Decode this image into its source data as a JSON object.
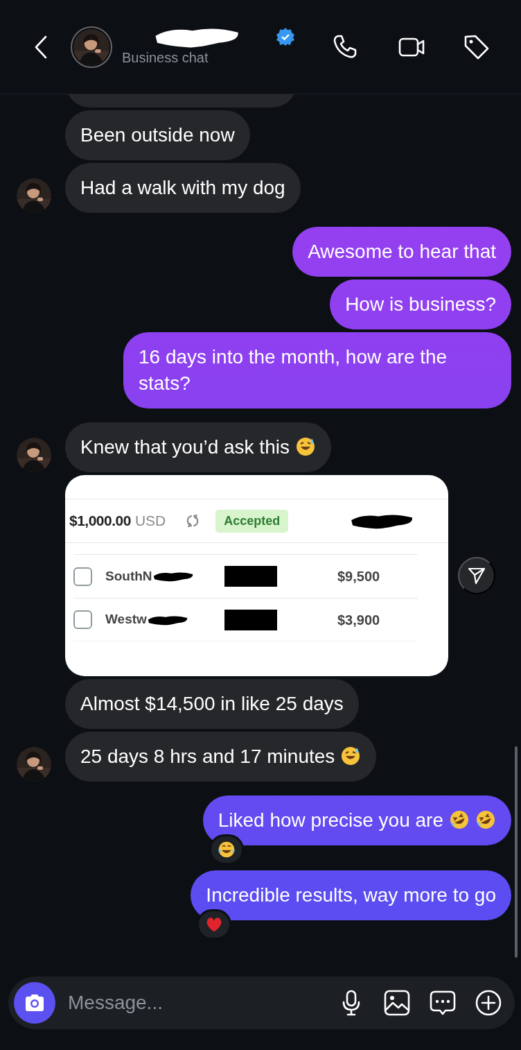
{
  "header": {
    "name_redacted": true,
    "verified": true,
    "subtitle": "Business chat"
  },
  "messages": [
    {
      "kind": "clipped"
    },
    {
      "kind": "incoming",
      "text": "Been outside now",
      "avatar": false
    },
    {
      "kind": "incoming",
      "text": "Had a walk with my dog",
      "avatar": true
    },
    {
      "kind": "outgoing",
      "text": "Awesome to hear that"
    },
    {
      "kind": "outgoing",
      "text": "How is business?"
    },
    {
      "kind": "outgoing",
      "text": "16 days into the month, how are the stats?"
    },
    {
      "kind": "incoming",
      "text": "Knew that you’d ask this",
      "avatar": true,
      "emojis": [
        {
          "kind": "sweat-smile"
        }
      ]
    },
    {
      "kind": "card",
      "avatar": false,
      "amount": "$1,000.00",
      "currency": "USD",
      "status": "Accepted",
      "ref_redacted": true,
      "rows": [
        {
          "name": "SouthN",
          "checked": false,
          "redacted": true,
          "amount": "$9,500"
        },
        {
          "name": "Westw",
          "checked": false,
          "redacted": true,
          "amount": "$3,900"
        }
      ]
    },
    {
      "kind": "incoming",
      "text": "Almost $14,500 in like 25 days",
      "avatar": false
    },
    {
      "kind": "incoming",
      "text": "25 days 8 hrs and 17 minutes",
      "avatar": true,
      "emojis": [
        {
          "kind": "sweat-smile"
        }
      ]
    },
    {
      "kind": "outgoing",
      "text": "Liked how precise you are",
      "emojis": [
        {
          "kind": "rofl"
        },
        {
          "kind": "rofl"
        }
      ],
      "reaction": {
        "kind": "joy"
      }
    },
    {
      "kind": "outgoing",
      "text": "Incredible results, way more to go",
      "reaction": {
        "kind": "heart"
      }
    }
  ],
  "composer": {
    "placeholder": "Message..."
  }
}
